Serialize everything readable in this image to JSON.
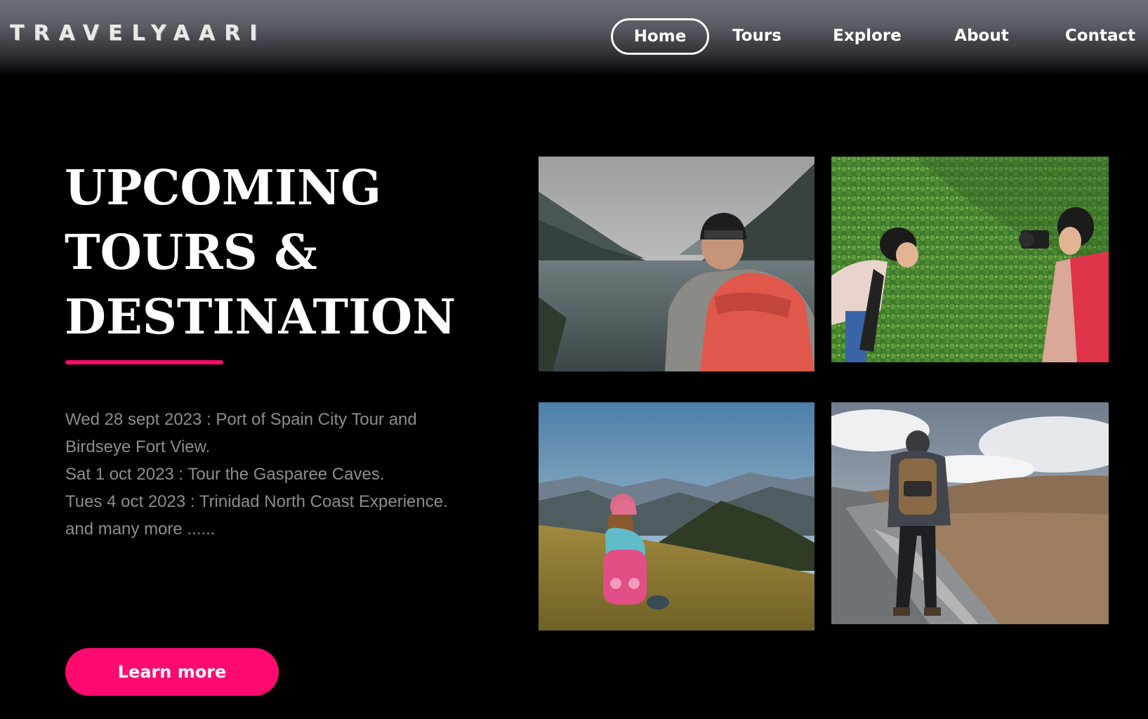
{
  "header": {
    "logo": "TRAVELYAARI",
    "nav": [
      {
        "label": "Home",
        "active": true
      },
      {
        "label": "Tours",
        "active": false
      },
      {
        "label": "Explore",
        "active": false
      },
      {
        "label": "About",
        "active": false
      },
      {
        "label": "Contact",
        "active": false
      }
    ]
  },
  "hero": {
    "title_lines": [
      "UPCOMING",
      "TOURS &",
      "DESTINATION"
    ],
    "accent_color": "#ff0a6e",
    "tours": [
      "Wed 28 sept 2023 : Port of Spain City Tour and Birdseye Fort View.",
      "Sat 1 oct 2023 : Tour the Gasparee Caves.",
      "Tues 4 oct 2023 : Trinidad North Coast Experience.",
      "and many more ......"
    ],
    "cta_label": "Learn more"
  },
  "gallery": [
    {
      "icon": "hiker-lake-photo"
    },
    {
      "icon": "photographers-ivy-wall-photo"
    },
    {
      "icon": "girl-mountains-photo"
    },
    {
      "icon": "hiker-stone-wall-photo"
    }
  ]
}
